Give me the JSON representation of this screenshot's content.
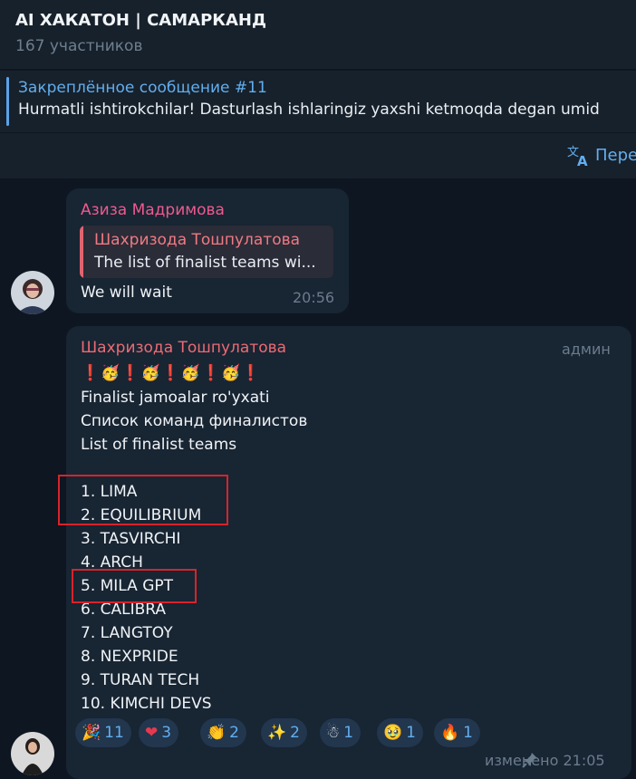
{
  "header": {
    "title": "AI ХАКАТОН | САМАРКАНД",
    "subtitle": "167 участников"
  },
  "pinned": {
    "title": "Закреплённое сообщение #11",
    "text": "Hurmatli ishtirokchilar!  Dasturlash ishlaringiz yaxshi ketmoqda degan umid"
  },
  "translate": {
    "label": "Пере"
  },
  "messages": [
    {
      "sender": "Азиза Мадримова",
      "sender_color": "#ee5a8e",
      "reply": {
        "name": "Шахризода Тошпулатова",
        "text": "The list of finalist teams wi..."
      },
      "text": "We will wait",
      "time": "20:56"
    },
    {
      "sender": "Шахризода Тошпулатова",
      "sender_color": "#ee6a73",
      "badge": "админ",
      "emoji_line": "❗🥳❗🥳❗🥳❗🥳❗",
      "lines": [
        "Finalist jamoalar ro'yxati",
        "Список команд финалистов",
        "List of finalist teams",
        "",
        "1. LIMA",
        "2. EQUILIBRIUM",
        "3. TASVIRCHI",
        "4. ARCH",
        "5. MILA GPT",
        "6. CALIBRA",
        "7. LANGTOY",
        "8. NEXPRIDE",
        "9. TURAN TECH",
        "10. KIMCHI DEVS"
      ],
      "reactions": [
        {
          "icon": "party-popper-icon",
          "glyph": "🎉",
          "count": "11"
        },
        {
          "icon": "heart-on-fire-icon",
          "glyph": "❤",
          "count": "3"
        },
        {
          "icon": "clapping-hands-icon",
          "glyph": "👏",
          "count": "2"
        },
        {
          "icon": "sparkle-icon",
          "glyph": "✨",
          "count": "2"
        },
        {
          "icon": "snowman-icon",
          "glyph": "☃",
          "count": "1"
        },
        {
          "icon": "teary-face-icon",
          "glyph": "🥹",
          "count": "1"
        },
        {
          "icon": "fire-icon",
          "glyph": "🔥",
          "count": "1"
        }
      ],
      "edited": "изменено 21:05"
    }
  ],
  "colors": {
    "background": "#0e1621",
    "panel": "#17212b",
    "bubble": "#182533",
    "accent": "#62aeef",
    "highlight_box": "#d8232a"
  }
}
